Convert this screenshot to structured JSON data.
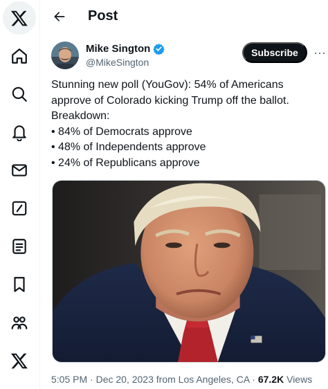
{
  "header": {
    "title": "Post"
  },
  "rail": {
    "items": [
      {
        "icon": "x-logo-icon"
      },
      {
        "icon": "home-icon"
      },
      {
        "icon": "search-icon"
      },
      {
        "icon": "notifications-icon"
      },
      {
        "icon": "messages-icon"
      },
      {
        "icon": "grok-icon"
      },
      {
        "icon": "lists-icon"
      },
      {
        "icon": "bookmarks-icon"
      },
      {
        "icon": "communities-icon"
      },
      {
        "icon": "premium-icon"
      }
    ]
  },
  "author": {
    "name": "Mike Sington",
    "handle": "@MikeSington",
    "verified": true,
    "verified_color": "#1d9bf0"
  },
  "actions": {
    "subscribe_label": "Subscribe",
    "more_label": "···"
  },
  "tweet": {
    "lines": [
      "Stunning new poll (YouGov): 54% of Americans",
      "approve of Colorado kicking Trump off the ballot.",
      "Breakdown:",
      "• 84% of Democrats approve",
      "• 48% of Independents approve",
      "• 24% of Republicans approve"
    ]
  },
  "meta": {
    "time": "5:05 PM",
    "separator": "·",
    "date": "Dec 20, 2023 from Los Angeles, CA",
    "views_count": "67.2K",
    "views_label": "Views"
  },
  "colors": {
    "text": "#0f1419",
    "secondary": "#536471",
    "accent": "#1d9bf0"
  }
}
